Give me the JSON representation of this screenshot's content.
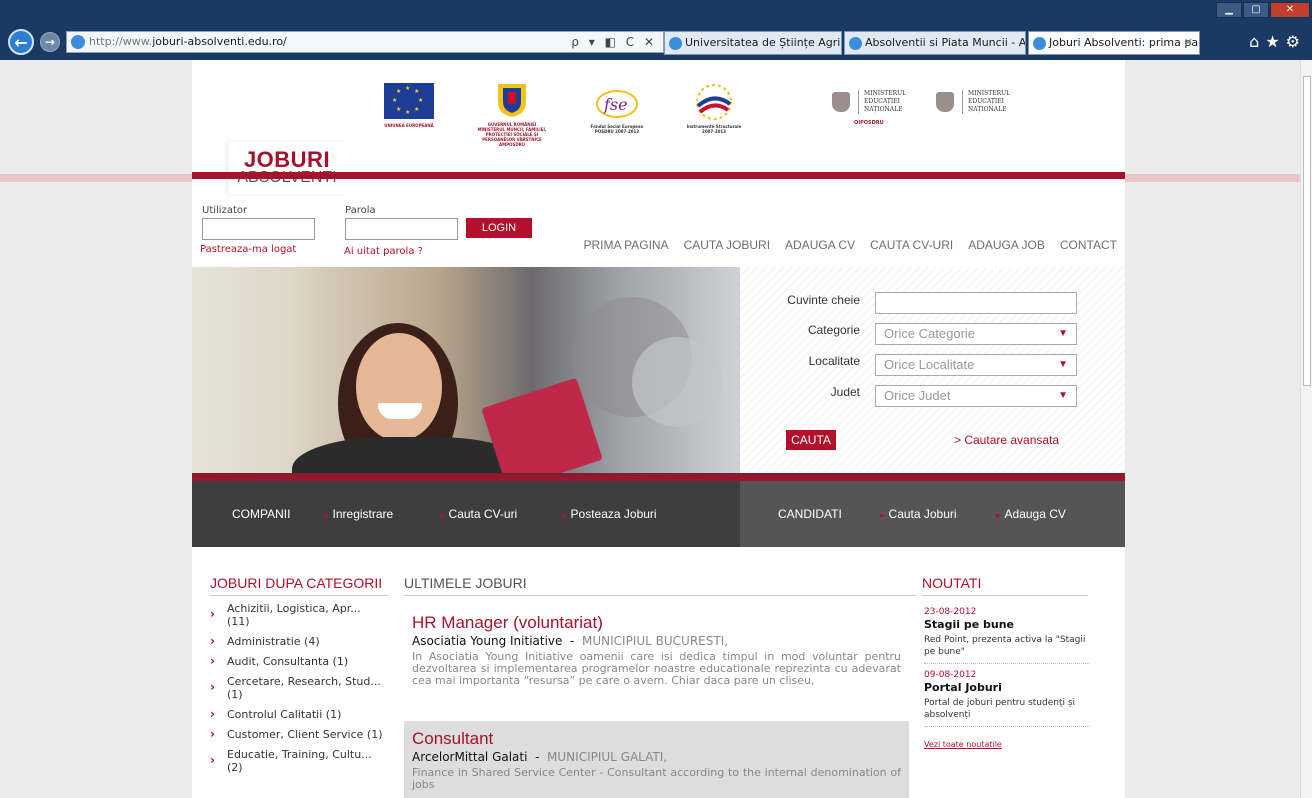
{
  "browser": {
    "url_prefix": "http://www.",
    "url_domain": "joburi-absolventi.edu.ro/",
    "address_tools": "ρ ▾ ◧ C ✕",
    "tabs": [
      {
        "label": "Universitatea de Științe Agricol...",
        "active": false
      },
      {
        "label": "Absolventii si Piata Muncii - A...",
        "active": false
      },
      {
        "label": "Joburi Absolventi: prima pa...",
        "active": true
      }
    ],
    "icons": [
      "home-icon",
      "favorites-star-icon",
      "settings-gear-icon"
    ]
  },
  "logos": {
    "eu_caption": "UNIUNEA EUROPEANĂ",
    "gov_caption": "GUVERNUL ROMÂNIEI MINISTERUL MUNCII, FAMILIEI, PROTECȚIEI SOCIALE ȘI PERSOANELOR VÂRSTNICE AMPOSDRU",
    "fse_caption": "Fondul Social European POSDRU 2007-2013",
    "instr_caption": "Instrumente Structurale 2007-2013",
    "men1_line1": "MINISTERUL",
    "men1_line2": "EDUCAȚIEI",
    "men1_line3": "NAȚIONALE",
    "men1_sub": "OIPOSDRU",
    "men2_line1": "MINISTERUL",
    "men2_line2": "EDUCAȚIEI",
    "men2_line3": "NAȚIONALE"
  },
  "brand": {
    "top": "JOBURI",
    "bottom": "ABSOLVENTI"
  },
  "login": {
    "user_label": "Utilizator",
    "pass_label": "Parola",
    "button": "LOGIN",
    "remember": "Pastreaza-ma logat",
    "forgot": "Ai uitat parola ?"
  },
  "nav": [
    "PRIMA PAGINA",
    "CAUTA JOBURI",
    "ADAUGA CV",
    "CAUTA CV-URI",
    "ADAUGA JOB",
    "CONTACT"
  ],
  "search": {
    "keywords_label": "Cuvinte cheie",
    "category_label": "Categorie",
    "category_value": "Orice Categorie",
    "locality_label": "Localitate",
    "locality_value": "Orice Localitate",
    "county_label": "Judet",
    "county_value": "Orice Judet",
    "button": "CAUTA",
    "advanced": "Cautare avansata"
  },
  "band": {
    "companies": "COMPANII",
    "register": "Inregistrare",
    "search_cvs": "Cauta CV-uri",
    "post_jobs": "Posteaza Joburi",
    "candidates": "CANDIDATI",
    "search_jobs": "Cauta Joburi",
    "add_cv": "Adauga CV"
  },
  "columns": {
    "categories": "JOBURI DUPA CATEGORII",
    "latest": "ULTIMELE JOBURI",
    "news": "NOUTATI"
  },
  "categories": [
    "Achizitii, Logistica, Apr... (11)",
    "Administratie (4)",
    "Audit, Consultanta (1)",
    "Cercetare, Research, Stud... (1)",
    "Controlul Calitatii (1)",
    "Customer, Client Service (1)",
    "Educatie, Training, Cultu... (2)"
  ],
  "jobs": [
    {
      "title": "HR Manager (voluntariat)",
      "company": "Asociatia Young Initiative",
      "location": "MUNICIPIUL BUCURESTI,",
      "description": "In Asociatia Young Initiative oamenii care isi dedica timpul in mod voluntar pentru dezvoltarea si implementarea programelor noastre educationale reprezinta cu adevarat cea mai importanta “resursa” pe care o avem. Chiar daca pare un cliseu,"
    },
    {
      "title": "Consultant",
      "company": "ArcelorMittal Galati",
      "location": "MUNICIPIUL GALATI,",
      "description": "Finance in Shared Service Center - Consultant according to the internal denomination of jobs"
    }
  ],
  "news": [
    {
      "date": "23-08-2012",
      "title": "Stagii pe bune",
      "text": "Red Point, prezenta activa la \"Stagii pe bune\""
    },
    {
      "date": "09-08-2012",
      "title": "Portal Joburi",
      "text": "Portal de joburi pentru studenți și absolvenți"
    }
  ],
  "news_all": "Vezi toate noutatile",
  "colors": {
    "brand_red": "#b3102b",
    "dark_band": "#3e3e3e",
    "chrome_blue": "#1a3a63"
  }
}
